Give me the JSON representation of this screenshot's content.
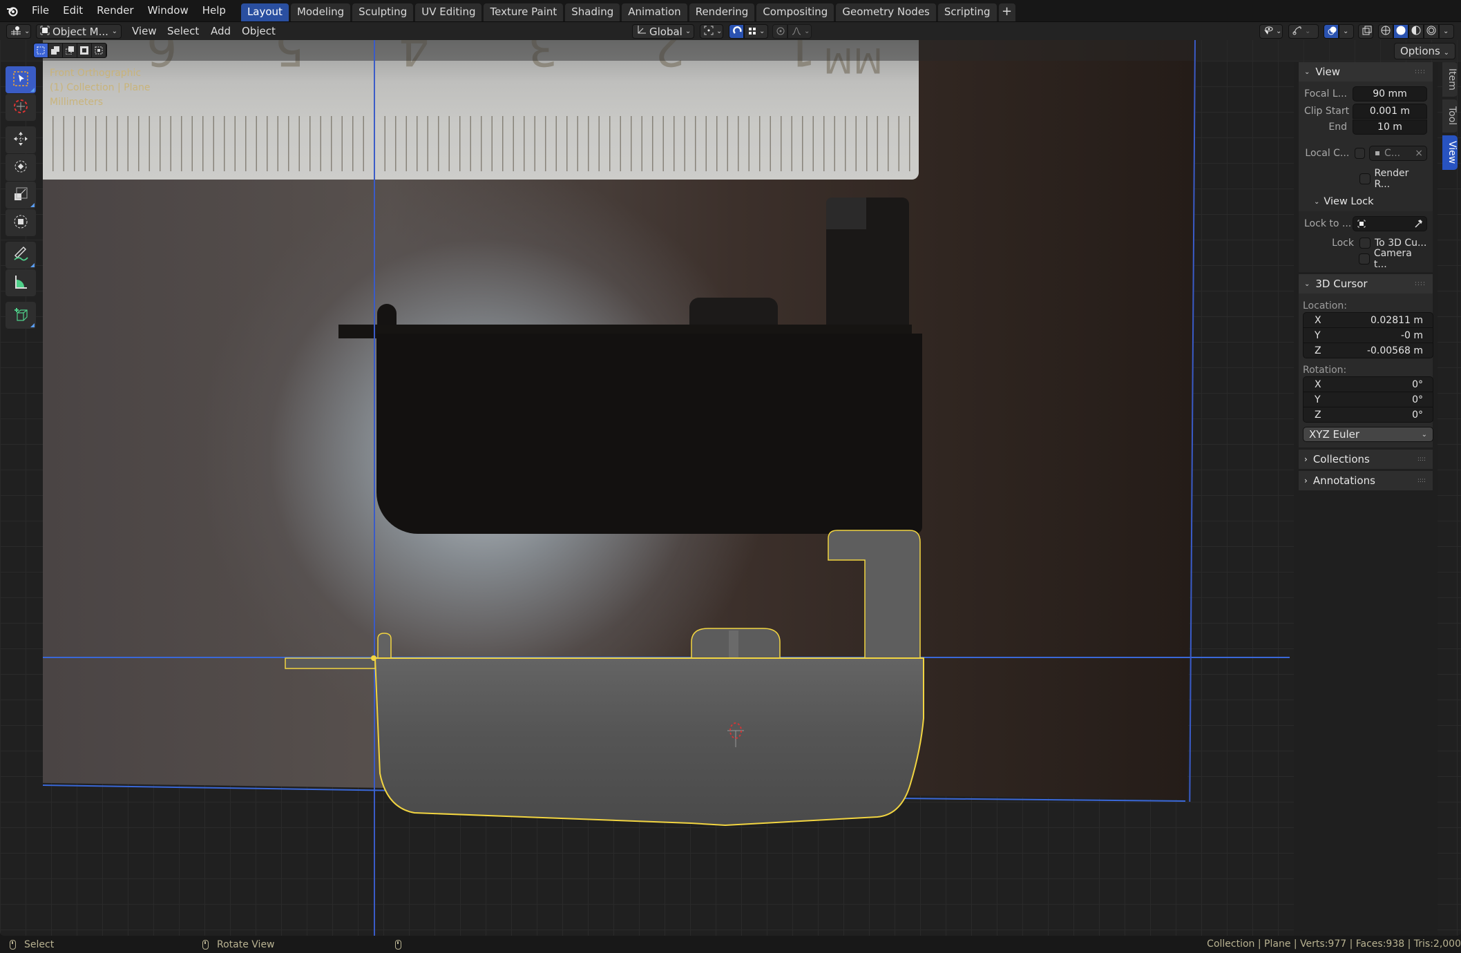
{
  "topbar": {
    "menus": [
      "File",
      "Edit",
      "Render",
      "Window",
      "Help"
    ],
    "workspaces": [
      "Layout",
      "Modeling",
      "Sculpting",
      "UV Editing",
      "Texture Paint",
      "Shading",
      "Animation",
      "Rendering",
      "Compositing",
      "Geometry Nodes",
      "Scripting"
    ],
    "active_workspace": "Layout",
    "add_workspace": "+"
  },
  "header": {
    "editor_type_icon": "viewport-icon",
    "mode": "Object M...",
    "menus": [
      "View",
      "Select",
      "Add",
      "Object"
    ],
    "transform_orientation": "Global",
    "pivot_icon": "pivot-icon",
    "snap_icon": "snap-magnet-icon",
    "snap_enabled": true,
    "snap_target_icon": "snap-grid-icon",
    "proportional_icon": "proportional-edit-icon",
    "falloff_icon": "falloff-curve-icon",
    "visibility_icon": "selectability-visibility-icon",
    "gizmo_icon": "gizmo-icon",
    "overlays_icon": "overlays-icon",
    "overlays_enabled": true,
    "xray_icon": "xray-icon",
    "shading_modes": [
      "wireframe",
      "solid",
      "material-preview",
      "rendered"
    ],
    "active_shading": "solid",
    "options_label": "Options"
  },
  "viewport": {
    "overlay_lines": [
      "Front Orthographic",
      "(1) Collection | Plane",
      "Millimeters"
    ],
    "select_modes": [
      "set",
      "extend",
      "subtract",
      "invert",
      "intersect"
    ],
    "active_select_mode": "set",
    "ruler_numbers": [
      "6",
      "5",
      "4",
      "3",
      "2",
      "1",
      "MM"
    ],
    "tools": [
      {
        "name": "select-box",
        "active": true
      },
      {
        "name": "cursor",
        "active": false
      },
      {
        "name": "move",
        "active": false
      },
      {
        "name": "rotate",
        "active": false
      },
      {
        "name": "scale",
        "active": false
      },
      {
        "name": "transform",
        "active": false
      },
      {
        "name": "annotate",
        "active": false
      },
      {
        "name": "measure",
        "active": false
      },
      {
        "name": "add-cube",
        "active": false
      }
    ],
    "colors": {
      "selection_outline": "#f2d541",
      "mesh_fill": "#5a5a5a",
      "axis_lines": "#3a68d8",
      "overlay_text": "#c9b47a"
    }
  },
  "npanel": {
    "tabs": [
      "Item",
      "Tool",
      "View"
    ],
    "active_tab": "View",
    "view": {
      "title": "View",
      "focal_label": "Focal L...",
      "focal_value": "90 mm",
      "clip_start_label": "Clip Start",
      "clip_start_value": "0.001 m",
      "clip_end_label": "End",
      "clip_end_value": "10 m",
      "local_camera_label": "Local C...",
      "local_camera_value": "C...",
      "render_region_label": "Render R...",
      "view_lock": {
        "title": "View Lock",
        "lock_to_label": "Lock to ...",
        "lock_label": "Lock",
        "to_3d_cursor_label": "To 3D Cu...",
        "camera_to_view_label": "Camera t..."
      }
    },
    "cursor": {
      "title": "3D Cursor",
      "location_label": "Location:",
      "location": [
        {
          "axis": "X",
          "value": "0.02811 m"
        },
        {
          "axis": "Y",
          "value": "-0 m"
        },
        {
          "axis": "Z",
          "value": "-0.00568 m"
        }
      ],
      "rotation_label": "Rotation:",
      "rotation": [
        {
          "axis": "X",
          "value": "0°"
        },
        {
          "axis": "Y",
          "value": "0°"
        },
        {
          "axis": "Z",
          "value": "0°"
        }
      ],
      "rotation_mode": "XYZ Euler"
    },
    "collapsed_sections": [
      "Collections",
      "Annotations"
    ]
  },
  "statusbar": {
    "left_action": "Select",
    "middle_action": "Rotate View",
    "right_action": "",
    "stats": "Collection | Plane | Verts:977 | Faces:938 | Tris:2,000"
  }
}
